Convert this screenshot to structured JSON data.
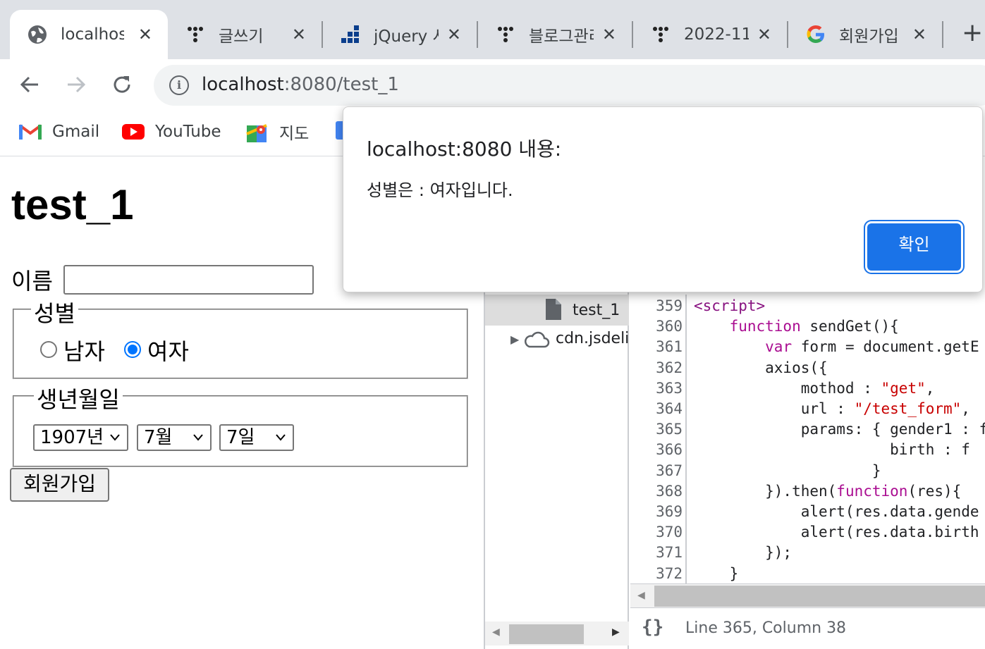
{
  "browser": {
    "tabs": [
      {
        "title": "localhost",
        "icon": "globe-icon",
        "active": true
      },
      {
        "title": "글쓰기",
        "icon": "tistory-icon"
      },
      {
        "title": "jQuery 사용",
        "icon": "jquery-icon"
      },
      {
        "title": "블로그관리",
        "icon": "tistory-icon"
      },
      {
        "title": "2022-11",
        "icon": "tistory-icon"
      },
      {
        "title": "회원가입",
        "icon": "google-icon"
      }
    ],
    "new_tab": "+",
    "close_glyph": "✕",
    "url_host": "localhost",
    "url_rest": ":8080/test_1",
    "bookmarks": [
      {
        "label": "Gmail",
        "icon": "gmail-icon"
      },
      {
        "label": "YouTube",
        "icon": "youtube-icon"
      },
      {
        "label": "지도",
        "icon": "maps-icon"
      }
    ]
  },
  "page": {
    "heading": "test_1",
    "name_label": "이름",
    "name_value": "",
    "gender_legend": "성별",
    "gender_options": [
      {
        "label": "남자",
        "checked": false
      },
      {
        "label": "여자",
        "checked": true
      }
    ],
    "birth_legend": "생년월일",
    "year": "1907년",
    "month": "7월",
    "day": "7일",
    "submit_label": "회원가입"
  },
  "devtools": {
    "tree_items": [
      "test_1",
      "cdn.jsdelivr"
    ],
    "code_lines": [
      {
        "n": "359",
        "html": "<span class=\"tag\">&lt;script&gt;</span>"
      },
      {
        "n": "360",
        "html": "    <span class=\"kw\">function</span> sendGet(){"
      },
      {
        "n": "361",
        "html": "        <span class=\"kw\">var</span> form = document.getE"
      },
      {
        "n": "362",
        "html": "        axios({"
      },
      {
        "n": "363",
        "html": "            mothod : <span class=\"str\">\"get\"</span>,"
      },
      {
        "n": "364",
        "html": "            url : <span class=\"str\">\"/test_form\"</span>,"
      },
      {
        "n": "365",
        "html": "            params: { gender1 : f"
      },
      {
        "n": "366",
        "html": "                      birth : f"
      },
      {
        "n": "367",
        "html": "                    }"
      },
      {
        "n": "368",
        "html": "        }).then(<span class=\"kw\">function</span>(res){"
      },
      {
        "n": "369",
        "html": "            alert(res.data.gende"
      },
      {
        "n": "370",
        "html": "            alert(res.data.birth"
      },
      {
        "n": "371",
        "html": "        });"
      },
      {
        "n": "372",
        "html": "    }"
      }
    ],
    "status": "Line 365, Column 38",
    "format_glyph": "{}"
  },
  "dialog": {
    "title": "localhost:8080 내용:",
    "message": "성별은 : 여자입니다.",
    "ok_label": "확인"
  },
  "colors": {
    "accent": "#1a73e8",
    "radio": "#0075ff",
    "keyword": "#aa0d91",
    "string": "#c80000"
  }
}
